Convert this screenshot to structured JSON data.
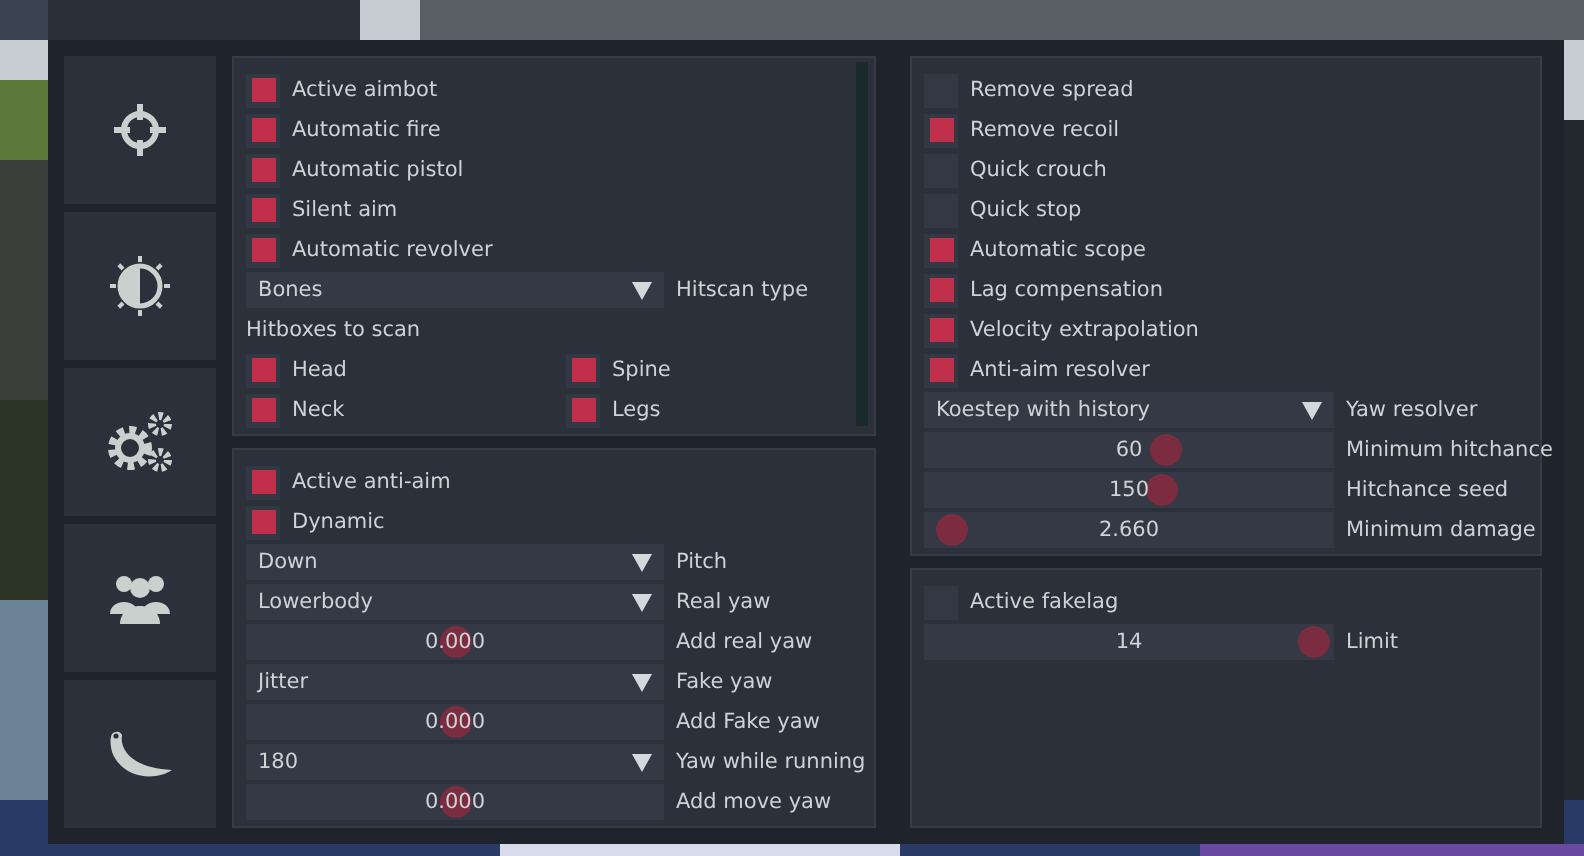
{
  "columns": [
    {
      "panels": [
        {
          "scrollbar": true,
          "items": [
            {
              "kind": "checkbox",
              "label": "Active aimbot",
              "checked": true
            },
            {
              "kind": "checkbox",
              "label": "Automatic fire",
              "checked": true
            },
            {
              "kind": "checkbox",
              "label": "Automatic pistol",
              "checked": true
            },
            {
              "kind": "checkbox",
              "label": "Silent aim",
              "checked": true
            },
            {
              "kind": "checkbox",
              "label": "Automatic revolver",
              "checked": true
            },
            {
              "kind": "dropdown",
              "option": "Bones",
              "setting": "Hitscan type"
            },
            {
              "kind": "heading",
              "label": "Hitboxes to scan"
            },
            {
              "kind": "grid",
              "items": [
                {
                  "label": "Head",
                  "checked": true
                },
                {
                  "label": "Spine",
                  "checked": true
                },
                {
                  "label": "Neck",
                  "checked": true
                },
                {
                  "label": "Legs",
                  "checked": true
                }
              ]
            }
          ]
        },
        {
          "scrollbar": false,
          "items": [
            {
              "kind": "checkbox",
              "label": "Active anti-aim",
              "checked": true
            },
            {
              "kind": "checkbox",
              "label": "Dynamic",
              "checked": true
            },
            {
              "kind": "dropdown",
              "option": "Down",
              "setting": "Pitch"
            },
            {
              "kind": "dropdown",
              "option": "Lowerbody",
              "setting": "Real yaw"
            },
            {
              "kind": "slider",
              "reading": "0.000",
              "level": 0.5,
              "setting": "Add real yaw"
            },
            {
              "kind": "dropdown",
              "option": "Jitter",
              "setting": "Fake yaw"
            },
            {
              "kind": "slider",
              "reading": "0.000",
              "level": 0.5,
              "setting": "Add Fake yaw"
            },
            {
              "kind": "dropdown",
              "option": "180",
              "setting": "Yaw while running"
            },
            {
              "kind": "slider",
              "reading": "0.000",
              "level": 0.5,
              "setting": "Add move yaw"
            }
          ]
        }
      ]
    },
    {
      "panels": [
        {
          "scrollbar": false,
          "items": [
            {
              "kind": "checkbox",
              "label": "Remove spread",
              "checked": false
            },
            {
              "kind": "checkbox",
              "label": "Remove recoil",
              "checked": true
            },
            {
              "kind": "checkbox",
              "label": "Quick crouch",
              "checked": false
            },
            {
              "kind": "checkbox",
              "label": "Quick stop",
              "checked": false
            },
            {
              "kind": "checkbox",
              "label": "Automatic scope",
              "checked": true
            },
            {
              "kind": "checkbox",
              "label": "Lag compensation",
              "checked": true
            },
            {
              "kind": "checkbox",
              "label": "Velocity extrapolation",
              "checked": true
            },
            {
              "kind": "checkbox",
              "label": "Anti-aim resolver",
              "checked": true
            },
            {
              "kind": "dropdown",
              "option": "Koestep with history",
              "setting": "Yaw resolver"
            },
            {
              "kind": "slider",
              "reading": "60",
              "level": 0.59,
              "setting": "Minimum hitchance"
            },
            {
              "kind": "slider",
              "reading": "150",
              "level": 0.58,
              "setting": "Hitchance seed"
            },
            {
              "kind": "slider",
              "reading": "2.660",
              "level": 0.07,
              "setting": "Minimum damage"
            }
          ]
        },
        {
          "scrollbar": false,
          "items": [
            {
              "kind": "checkbox",
              "label": "Active fakelag",
              "checked": false
            },
            {
              "kind": "slider",
              "reading": "14",
              "level": 0.95,
              "setting": "Limit"
            }
          ]
        }
      ]
    }
  ]
}
